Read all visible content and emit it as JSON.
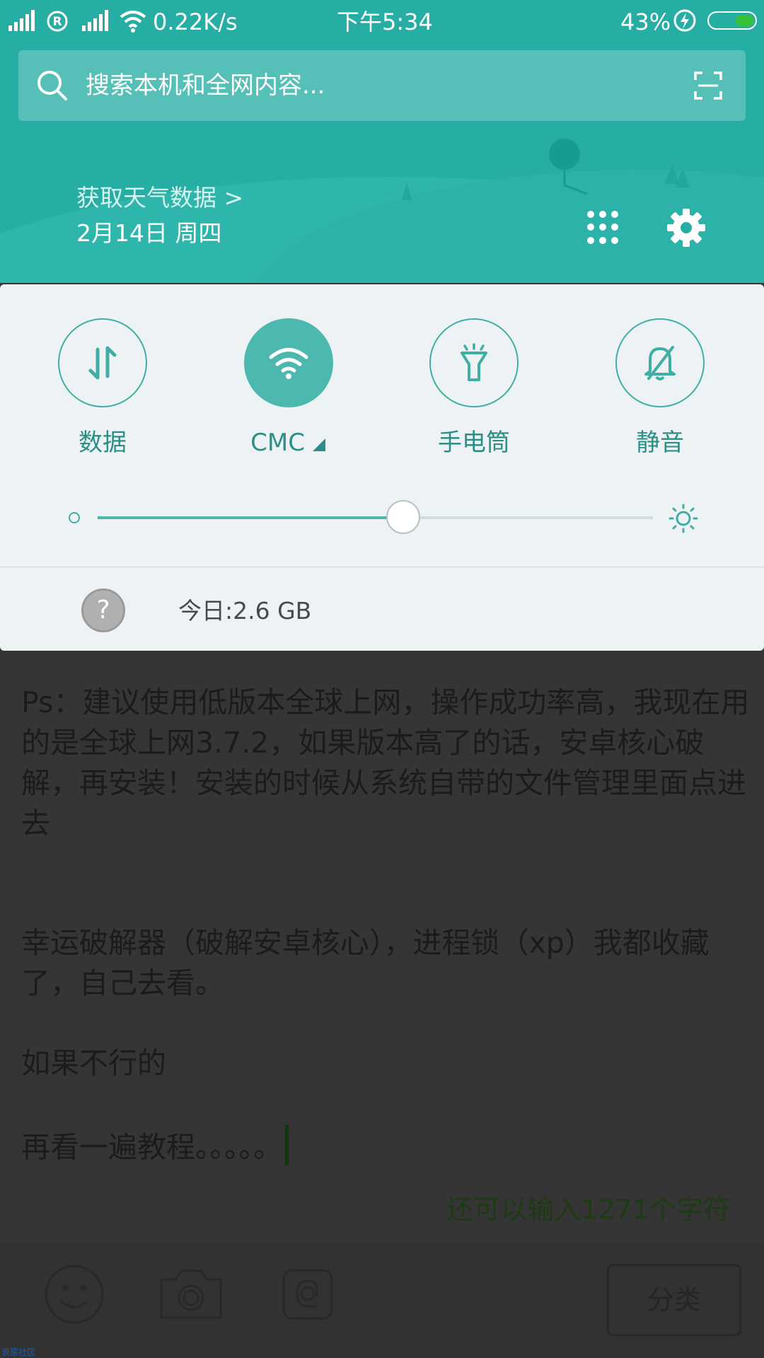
{
  "status_bar": {
    "network_speed": "0.22K/s",
    "time": "下午5:34",
    "battery_percent": "43%",
    "battery_level": 0.43
  },
  "search": {
    "placeholder": "搜索本机和全网内容..."
  },
  "header": {
    "weather_link": "获取天气数据 >",
    "date": "2月14日 周四"
  },
  "quick_settings": {
    "tiles": [
      {
        "label": "数据",
        "icon": "data-arrows-icon",
        "active": false
      },
      {
        "label": "CMC",
        "icon": "wifi-icon",
        "active": true
      },
      {
        "label": "手电筒",
        "icon": "flashlight-icon",
        "active": false
      },
      {
        "label": "静音",
        "icon": "bell-off-icon",
        "active": false
      }
    ],
    "brightness_level": 0.55,
    "data_usage": {
      "help_symbol": "?",
      "today": "今日:2.6 GB"
    }
  },
  "editor": {
    "paragraph1": "Ps：建议使用低版本全球上网，操作成功率高，我现在用的是全球上网3.7.2，如果版本高了的话，安卓核心破解，再安装！安装的时候从系统自带的文件管理里面点进去",
    "paragraph2": "幸运破解器（破解安卓核心），进程锁（xp）我都收藏了，自己去看。",
    "paragraph3": "如果不行的",
    "paragraph4": "再看一遍教程。。。。。",
    "char_count": "还可以输入1271个字符"
  },
  "toolbar": {
    "category_label": "分类"
  },
  "watermark": "浪尿社区",
  "colors": {
    "accent": "#27aea4",
    "panel": "#edf3f5",
    "overlay": "#353535"
  }
}
